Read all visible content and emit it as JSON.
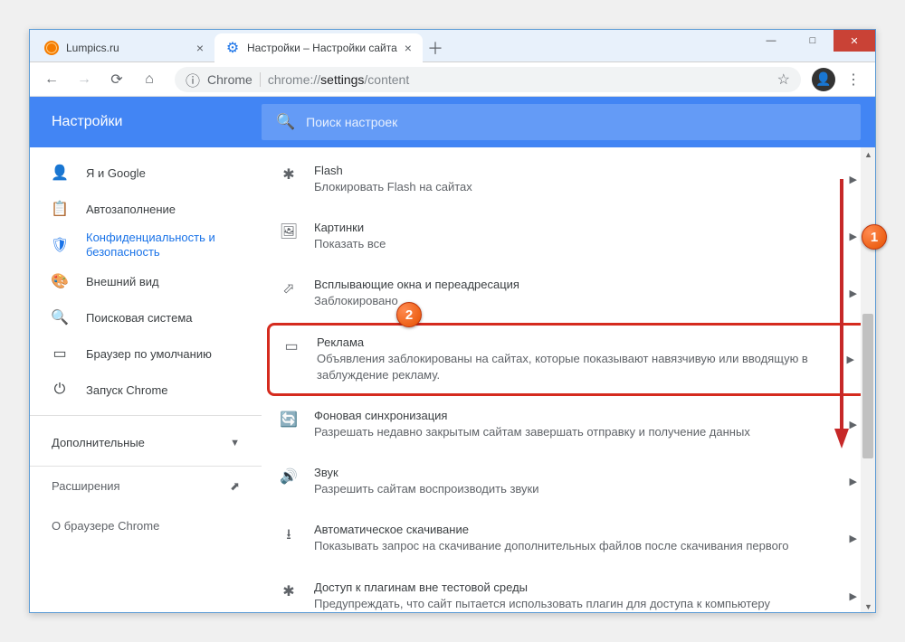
{
  "window_controls": {
    "min": "—",
    "max": "□",
    "close": "✕"
  },
  "tabs": [
    {
      "title": "Lumpics.ru",
      "icon": "orange"
    },
    {
      "title": "Настройки – Настройки сайта",
      "icon": "gear"
    }
  ],
  "toolbar": {
    "chrome_label": "Chrome",
    "url_prefix": "chrome://",
    "url_main": "settings",
    "url_path": "/content"
  },
  "header": {
    "title": "Настройки",
    "search_placeholder": "Поиск настроек"
  },
  "sidebar": {
    "items": [
      {
        "label": "Я и Google"
      },
      {
        "label": "Автозаполнение"
      },
      {
        "label": "Конфиденциальность и безопасность"
      },
      {
        "label": "Внешний вид"
      },
      {
        "label": "Поисковая система"
      },
      {
        "label": "Браузер по умолчанию"
      },
      {
        "label": "Запуск Chrome"
      }
    ],
    "advanced": "Дополнительные",
    "extensions": "Расширения",
    "about": "О браузере Chrome"
  },
  "content": [
    {
      "title": "Flash",
      "sub": "Блокировать Flash на сайтах"
    },
    {
      "title": "Картинки",
      "sub": "Показать все"
    },
    {
      "title": "Всплывающие окна и переадресация",
      "sub": "Заблокировано"
    },
    {
      "title": "Реклама",
      "sub": "Объявления заблокированы на сайтах, которые показывают навязчивую или вводящую в заблуждение рекламу."
    },
    {
      "title": "Фоновая синхронизация",
      "sub": "Разрешать недавно закрытым сайтам завершать отправку и получение данных"
    },
    {
      "title": "Звук",
      "sub": "Разрешить сайтам воспроизводить звуки"
    },
    {
      "title": "Автоматическое скачивание",
      "sub": "Показывать запрос на скачивание дополнительных файлов после скачивания первого"
    },
    {
      "title": "Доступ к плагинам вне тестовой среды",
      "sub": "Предупреждать, что сайт пытается использовать плагин для доступа к компьютеру"
    }
  ],
  "annotations": {
    "a1": "1",
    "a2": "2"
  }
}
